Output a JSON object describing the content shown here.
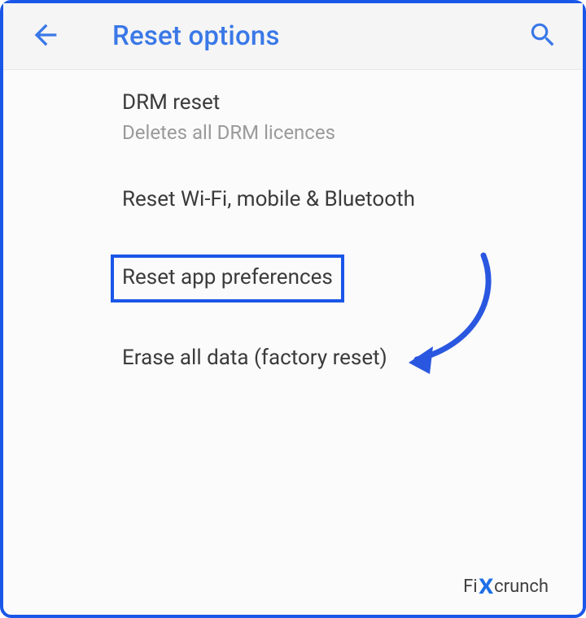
{
  "accent_color": "#1a56e8",
  "header": {
    "title": "Reset options"
  },
  "items": [
    {
      "title": "DRM reset",
      "subtitle": "Deletes all DRM licences"
    },
    {
      "title": "Reset Wi-Fi, mobile & Bluetooth"
    },
    {
      "title": "Reset app preferences"
    },
    {
      "title": "Erase all data (factory reset)"
    }
  ],
  "highlight_index": 2,
  "watermark": {
    "pre": "Fi",
    "x": "X",
    "post": "crunch"
  }
}
